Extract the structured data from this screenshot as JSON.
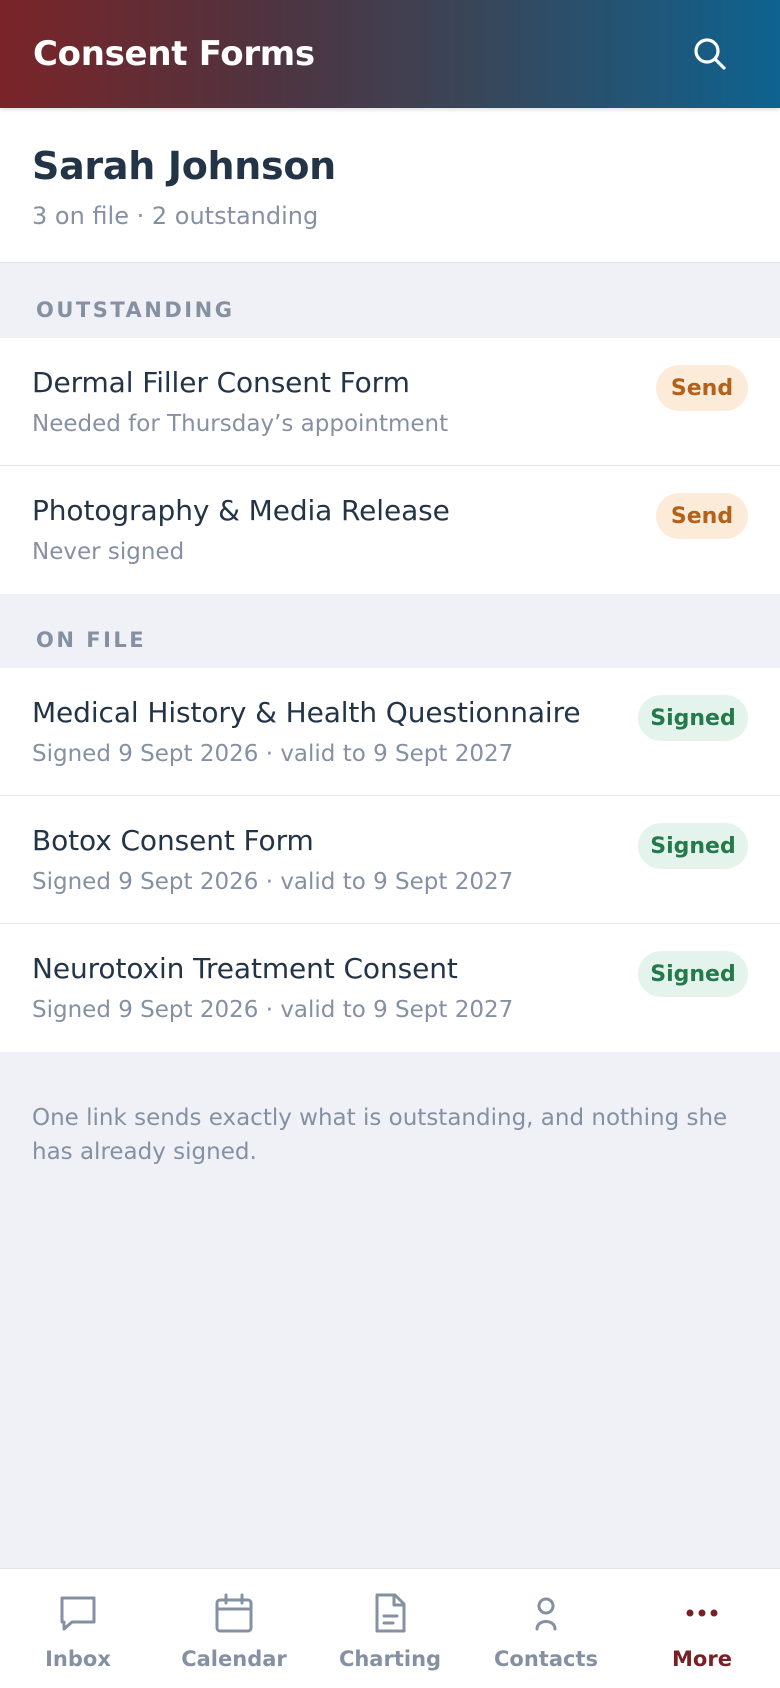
{
  "header": {
    "title": "Consent Forms",
    "search_icon": "search-icon"
  },
  "patient": {
    "name": "Sarah Johnson",
    "summary": "3 on file · 2 outstanding"
  },
  "sections": {
    "outstanding": {
      "label": "OUTSTANDING",
      "items": [
        {
          "title": "Dermal Filler Consent Form",
          "subtitle": "Needed for Thursday’s appointment",
          "action": "Send"
        },
        {
          "title": "Photography & Media Release",
          "subtitle": "Never signed",
          "action": "Send"
        }
      ]
    },
    "on_file": {
      "label": "ON FILE",
      "items": [
        {
          "title": "Medical History & Health Questionnaire",
          "subtitle": "Signed 9 Sept 2026 · valid to 9 Sept 2027",
          "status": "Signed"
        },
        {
          "title": "Botox Consent Form",
          "subtitle": "Signed 9 Sept 2026 · valid to 9 Sept 2027",
          "status": "Signed"
        },
        {
          "title": "Neurotoxin Treatment Consent",
          "subtitle": "Signed 9 Sept 2026 · valid to 9 Sept 2027",
          "status": "Signed"
        }
      ]
    }
  },
  "footnote": "One link sends exactly what is outstanding, and nothing she has already signed.",
  "bottom_nav": {
    "items": [
      {
        "label": "Inbox",
        "icon": "chat-bubble-icon"
      },
      {
        "label": "Calendar",
        "icon": "calendar-icon"
      },
      {
        "label": "Charting",
        "icon": "document-icon"
      },
      {
        "label": "Contacts",
        "icon": "person-icon"
      },
      {
        "label": "More",
        "icon": "more-dots-icon",
        "active": true
      }
    ]
  },
  "colors": {
    "brand_dark_red": "#7a1f24",
    "brand_blue": "#0d6390",
    "send_bg": "#fdebd9",
    "send_text": "#b3611b",
    "signed_bg": "#e4f4ec",
    "signed_text": "#237a4b"
  }
}
